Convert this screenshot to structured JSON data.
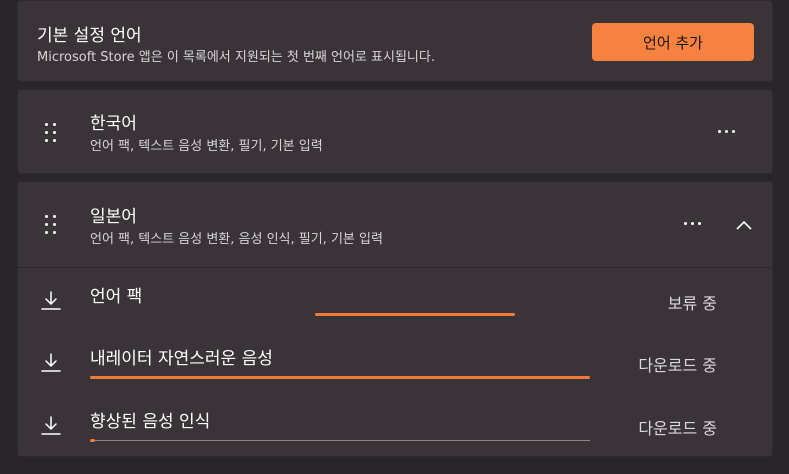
{
  "preferred_language": {
    "title": "기본 설정 언어",
    "description": "Microsoft Store 앱은 이 목록에서 지원되는 첫 번째 언어로 표시됩니다.",
    "add_button_label": "언어 추가"
  },
  "languages": [
    {
      "name": "한국어",
      "features": "언어 팩, 텍스트 음성 변환, 필기, 기본 입력"
    },
    {
      "name": "일본어",
      "features": "언어 팩, 텍스트 음성 변환, 음성 인식, 필기, 기본 입력"
    }
  ],
  "downloads": [
    {
      "label": "언어 팩",
      "status": "보류 중",
      "progress": 0.0
    },
    {
      "label": "내레이터 자연스러운 음성",
      "status": "다운로드 중",
      "progress": 1.0
    },
    {
      "label": "향상된 음성 인식",
      "status": "다운로드 중",
      "progress": 0.01
    }
  ],
  "colors": {
    "accent": "#f7823f",
    "card": "#3a3438",
    "background": "#2a2528"
  },
  "icons": {
    "drag": "drag-grip-icon",
    "more": "more-options-icon",
    "collapse": "chevron-up-icon",
    "download": "download-icon"
  }
}
